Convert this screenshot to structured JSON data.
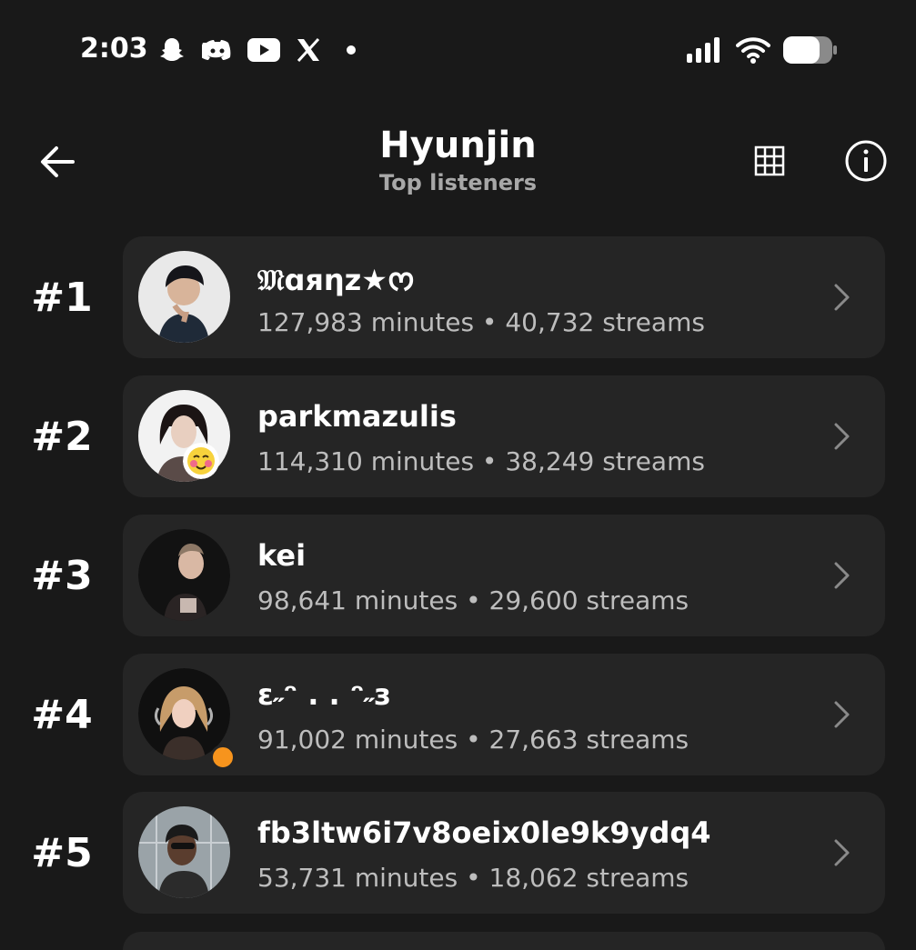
{
  "status_bar": {
    "time": "2:03",
    "left_icons": [
      "snapchat-icon",
      "discord-icon",
      "youtube-icon",
      "x-icon",
      "dot-icon"
    ],
    "right_icons": [
      "signal-icon",
      "wifi-icon",
      "battery-icon"
    ]
  },
  "header": {
    "title": "Hyunjin",
    "subtitle": "Top listeners",
    "back_icon": "arrow-left-icon",
    "grid_icon": "grid-icon",
    "info_icon": "info-icon"
  },
  "listeners": [
    {
      "rank": "#1",
      "name": "𝔐ɑяηz★ᰔ",
      "stats": "127,983 minutes • 40,732 streams"
    },
    {
      "rank": "#2",
      "name": "parkmazulis",
      "stats": "114,310 minutes • 38,249 streams"
    },
    {
      "rank": "#3",
      "name": "kei",
      "stats": "98,641 minutes • 29,600 streams"
    },
    {
      "rank": "#4",
      "name": "ɛ˶ᵔ . . ᵔ˶з",
      "stats": "91,002 minutes • 27,663 streams"
    },
    {
      "rank": "#5",
      "name": "fb3ltw6i7v8oeix0le9k9ydq4",
      "stats": "53,731 minutes • 18,062 streams"
    }
  ],
  "colors": {
    "background": "#191919",
    "card": "#252525",
    "text": "#ffffff",
    "muted": "#bdbdbd",
    "status_dot": "#f7941d"
  }
}
